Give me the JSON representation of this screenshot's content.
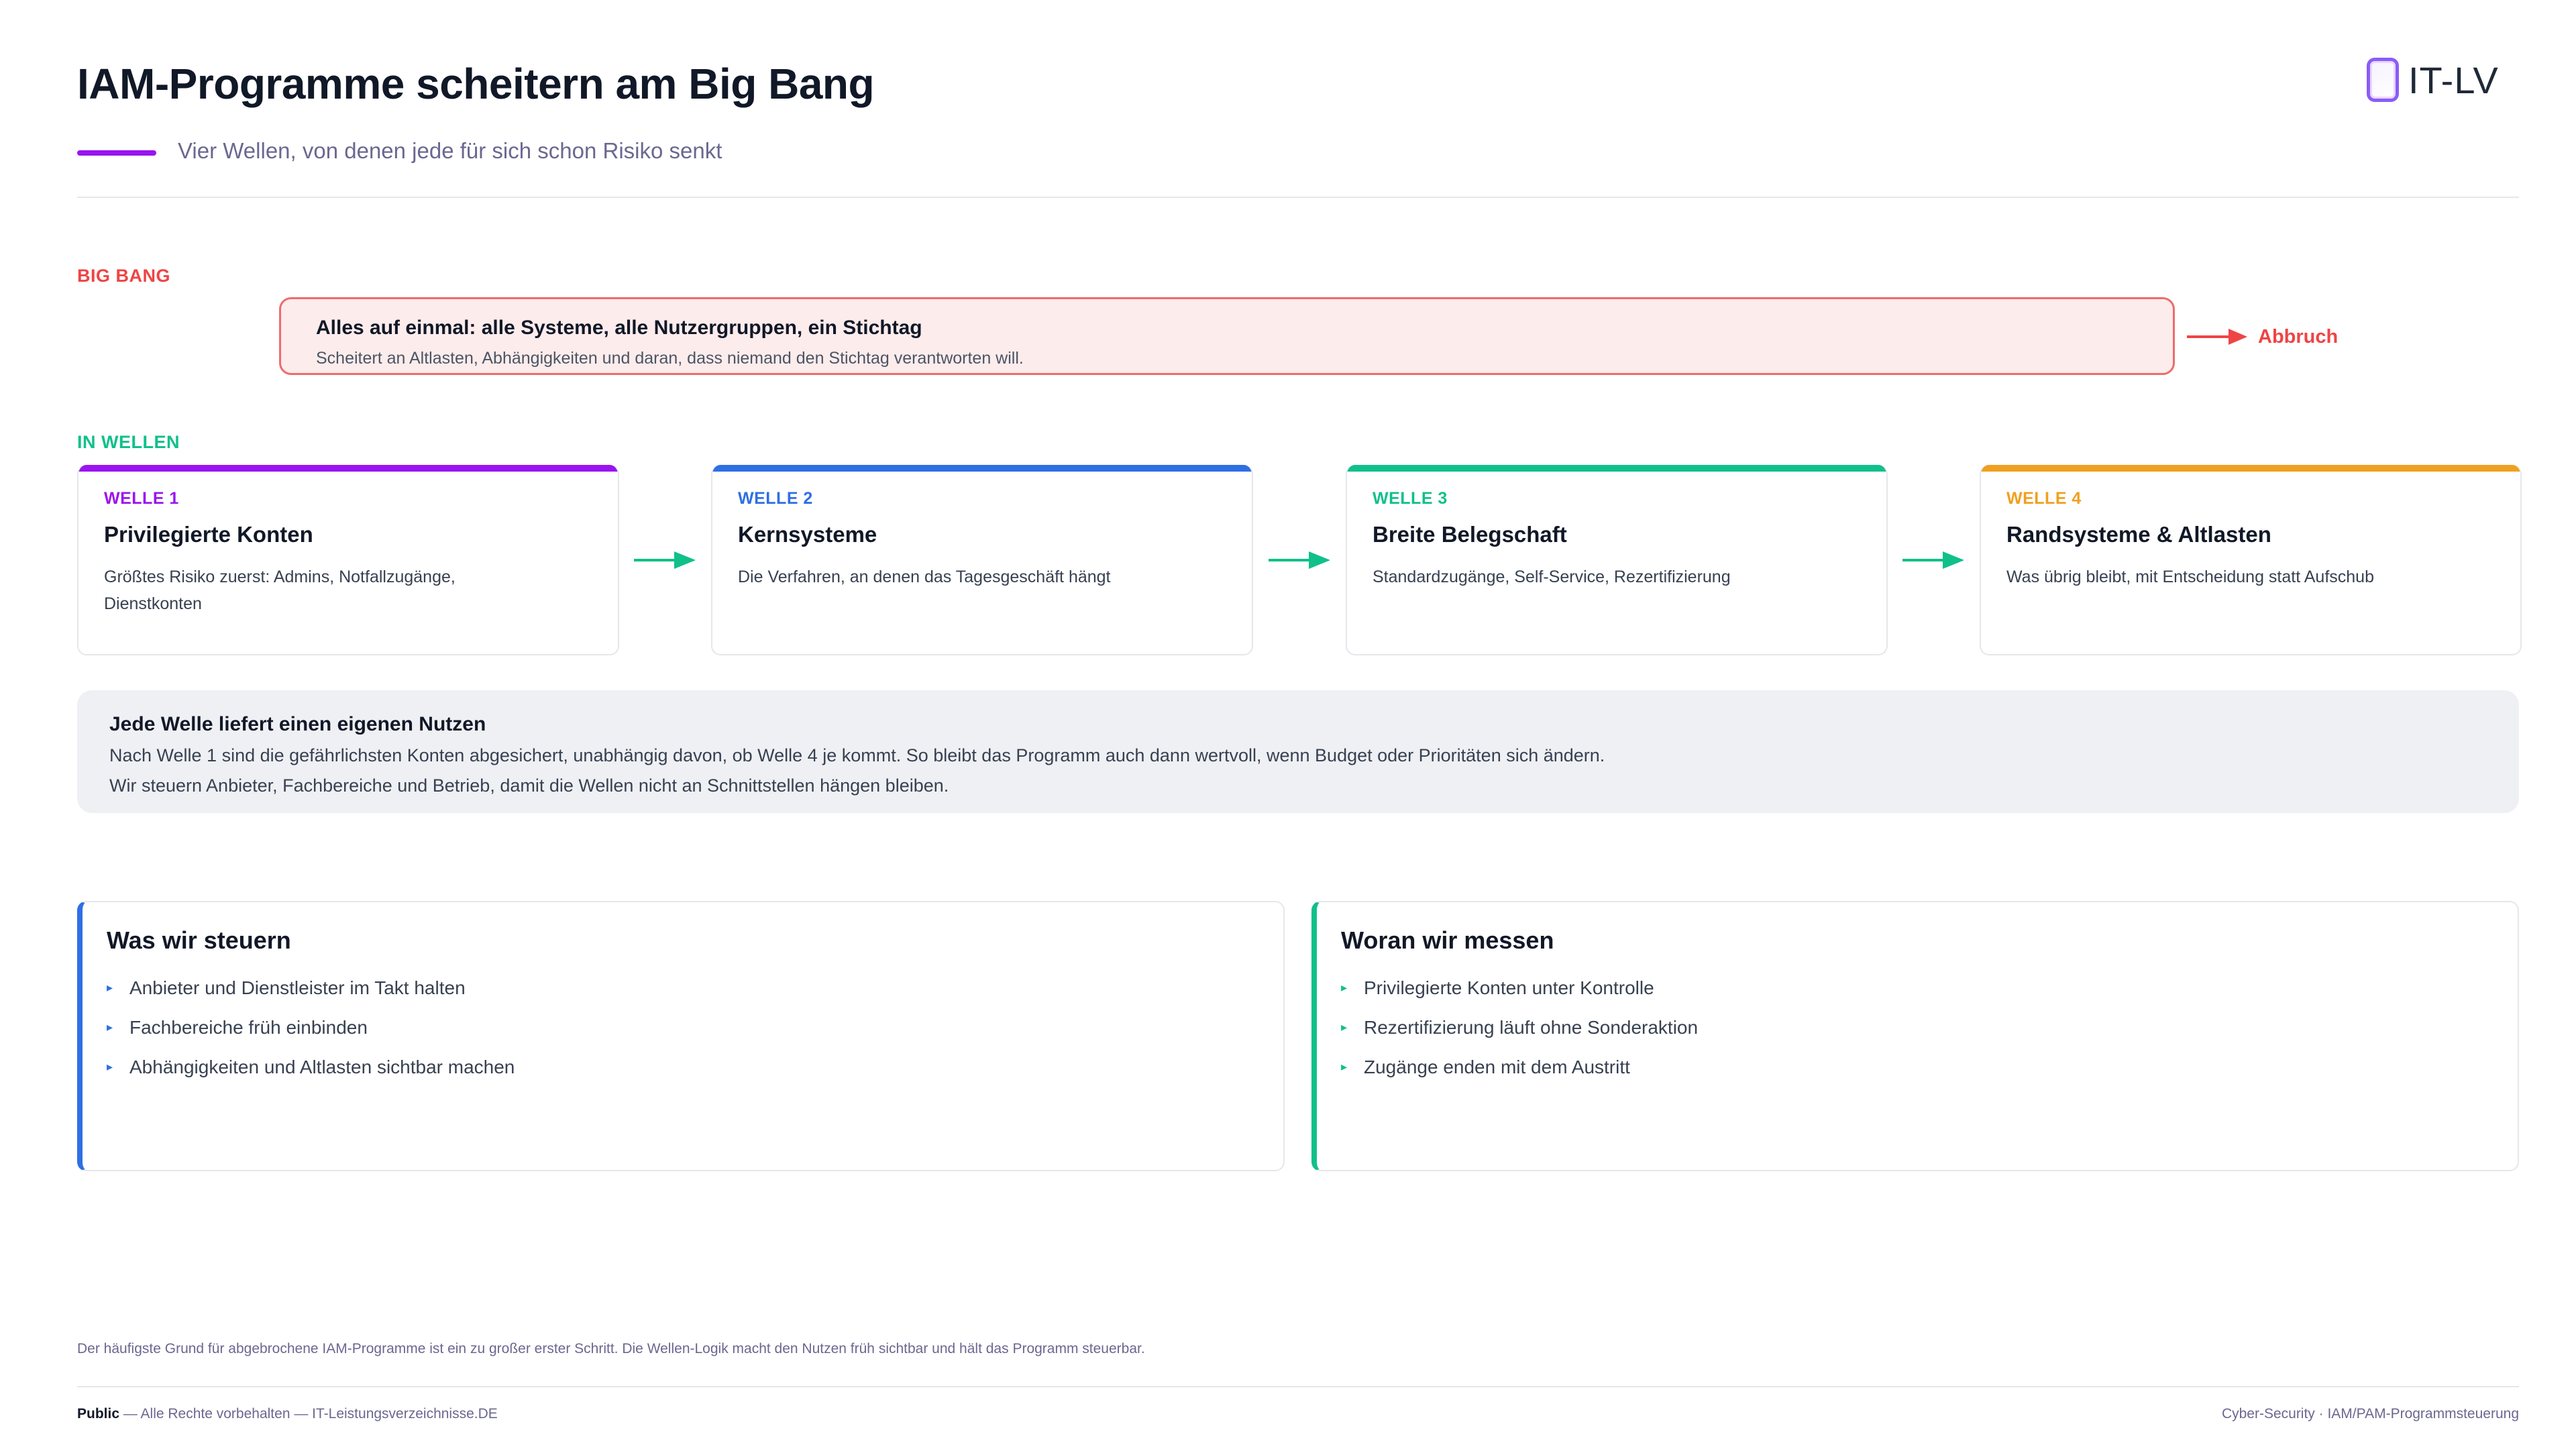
{
  "header": {
    "title": "IAM-Programme scheitern am Big Bang",
    "subtitle": "Vier Wellen, von denen jede für sich schon Risiko senkt",
    "logo_text": "IT-LV"
  },
  "big_bang": {
    "section_label": "BIG BANG",
    "headline": "Alles auf einmal: alle Systeme, alle Nutzergruppen, ein Stichtag",
    "text": "Scheitert an Altlasten, Abhängigkeiten und daran, dass niemand den Stichtag verantworten will.",
    "outcome": "Abbruch"
  },
  "waves": {
    "section_label": "IN WELLEN",
    "items": [
      {
        "label": "WELLE 1",
        "title": "Privilegierte Konten",
        "desc": "Größtes Risiko zuerst: Admins, Notfallzugänge, Dienstkonten",
        "color": "#9a14f0"
      },
      {
        "label": "WELLE 2",
        "title": "Kernsysteme",
        "desc": "Die Verfahren, an denen das Tagesgeschäft hängt",
        "color": "#2f6fe4"
      },
      {
        "label": "WELLE 3",
        "title": "Breite Belegschaft",
        "desc": "Standardzugänge, Self-Service, Rezertifizierung",
        "color": "#10c08a"
      },
      {
        "label": "WELLE 4",
        "title": "Randsysteme & Altlasten",
        "desc": "Was übrig bleibt, mit Entscheidung statt Aufschub",
        "color": "#f0a020"
      }
    ]
  },
  "benefit": {
    "headline": "Jede Welle liefert einen eigenen Nutzen",
    "line1": "Nach Welle 1 sind die gefährlichsten Konten abgesichert, unabhängig davon, ob Welle 4 je kommt. So bleibt das Programm auch dann wertvoll, wenn Budget oder Prioritäten sich ändern.",
    "line2": "Wir steuern Anbieter, Fachbereiche und Betrieb, damit die Wellen nicht an Schnittstellen hängen bleiben."
  },
  "steer": {
    "title": "Was wir steuern",
    "accent": "#2f6fe4",
    "items": [
      "Anbieter und Dienstleister im Takt halten",
      "Fachbereiche früh einbinden",
      "Abhängigkeiten und Altlasten sichtbar machen"
    ]
  },
  "measure": {
    "title": "Woran wir messen",
    "accent": "#10c08a",
    "items": [
      "Privilegierte Konten unter Kontrolle",
      "Rezertifizierung läuft ohne Sonderaktion",
      "Zugänge enden mit dem Austritt"
    ]
  },
  "footer": {
    "note": "Der häufigste Grund für abgebrochene IAM-Programme ist ein zu großer erster Schritt. Die Wellen-Logik macht den Nutzen früh sichtbar und hält das Programm steuerbar.",
    "classification": "Public",
    "rights": " — Alle Rechte vorbehalten — IT-Leistungsverzeichnisse.DE",
    "right": "Cyber-Security · IAM/PAM-Programmsteuerung"
  }
}
